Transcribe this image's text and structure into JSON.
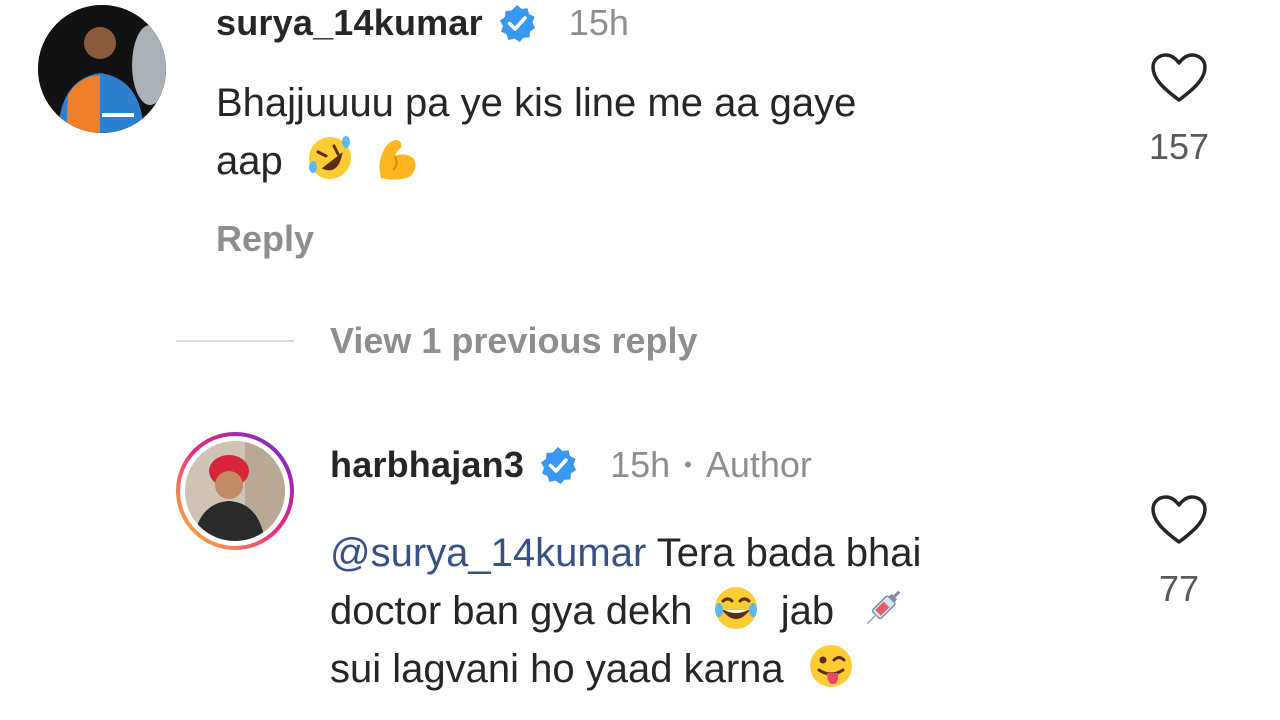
{
  "comments": [
    {
      "username": "surya_14kumar",
      "time": "15h",
      "line1": "Bhajjuuuu pa ye kis line me aa gaye",
      "line2": "aap",
      "emojis": [
        "rolling-laughing-emoji",
        "flexed-biceps-emoji"
      ],
      "reply_label": "Reply",
      "likes": "157"
    }
  ],
  "view_replies": "View 1 previous reply",
  "reply": {
    "username": "harbhajan3",
    "time": "15h",
    "separator": "•",
    "badge": "Author",
    "mention": "@surya_14kumar",
    "line1_rest": "Tera bada bhai",
    "line2_pre": "doctor ban gya dekh",
    "line2_mid": "jab",
    "line3": "sui lagvani ho yaad karna",
    "emojis": [
      "tears-of-joy-emoji",
      "syringe-emoji",
      "winking-tongue-emoji"
    ],
    "likes": "77"
  },
  "colors": {
    "verified": "#3897f0",
    "secondary_text": "#8e8e8e",
    "mention": "#385185",
    "story_ring_start": "#f9ce34",
    "story_ring_end": "#ee2a7b"
  }
}
